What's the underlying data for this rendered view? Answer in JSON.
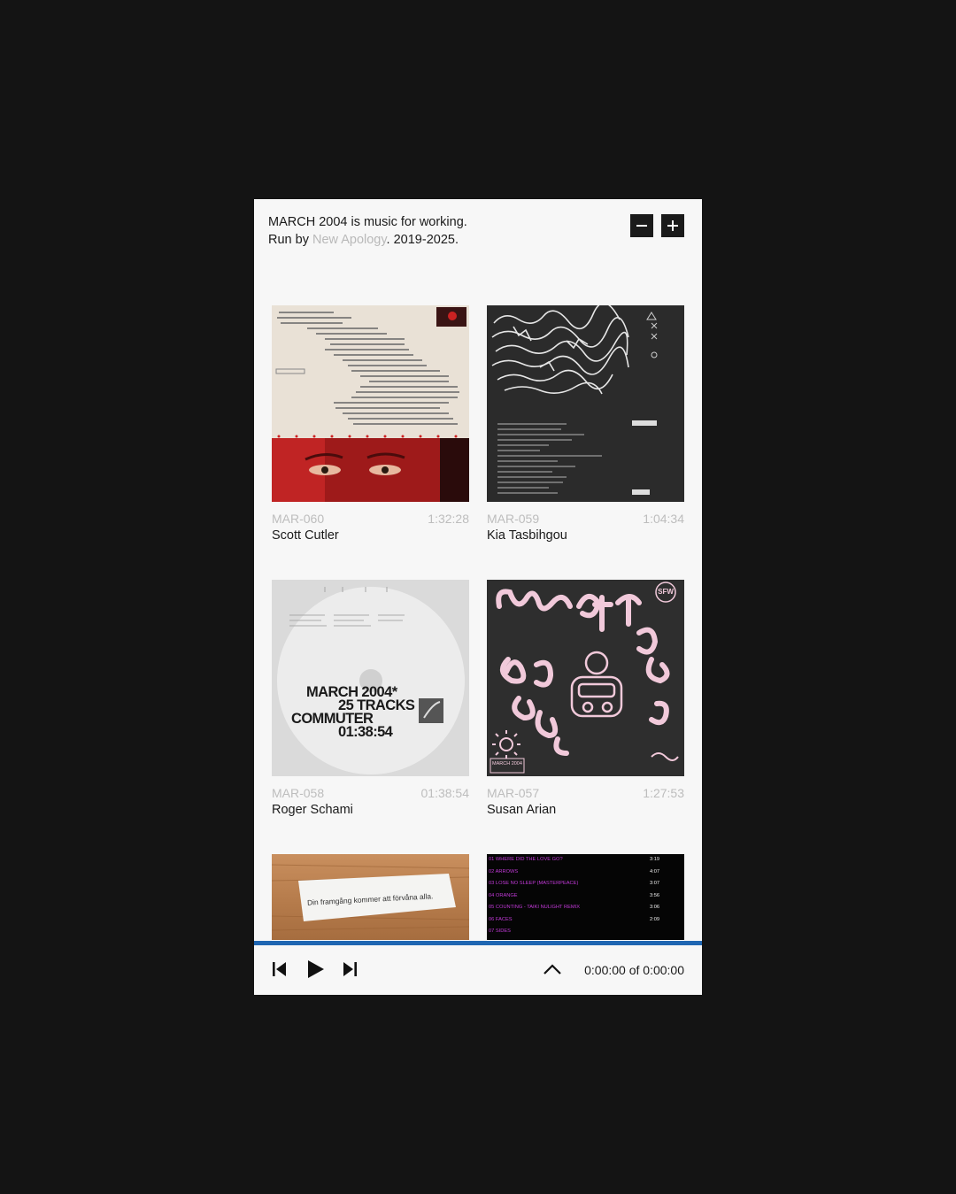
{
  "intro": {
    "line1": "MARCH 2004 is music for working.",
    "line2_prefix": "Run by ",
    "line2_link": "New Apology",
    "line2_suffix": ". 2019-2025."
  },
  "releases": [
    {
      "code": "MAR-060",
      "duration": "1:32:28",
      "artist": "Scott Cutler"
    },
    {
      "code": "MAR-059",
      "duration": "1:04:34",
      "artist": "Kia Tasbihgou"
    },
    {
      "code": "MAR-058",
      "duration": "01:38:54",
      "artist": "Roger Schami",
      "cover_text": [
        "MARCH 2004*",
        "25 TRACKS",
        "COMMUTER",
        "01:38:54"
      ]
    },
    {
      "code": "MAR-057",
      "duration": "1:27:53",
      "artist": "Susan Arian",
      "cover_badge": "SFW",
      "cover_tag": "MARCH 2004"
    },
    {
      "cover_text": "Din framgång kommer att förvåna alla."
    },
    {
      "cover_lines": [
        "01 WHERE DID THE LOVE GO?",
        "02 ARROWS",
        "03 LOSE NO SLEEP (MASTERPEACE)",
        "04 ORANGE",
        "05 COUNTING - TAIKI NULIGHT REMIX",
        "06 FACES",
        "07 SIDES"
      ],
      "cover_right": [
        "3:19",
        "4:07",
        "3:07",
        "3:56",
        "3:06",
        "2:09"
      ]
    }
  ],
  "player": {
    "progress": 0,
    "time": "0:00:00 of 0:00:00",
    "icons": [
      "skip-back-icon",
      "play-icon",
      "skip-forward-icon",
      "chevron-up-icon"
    ]
  }
}
